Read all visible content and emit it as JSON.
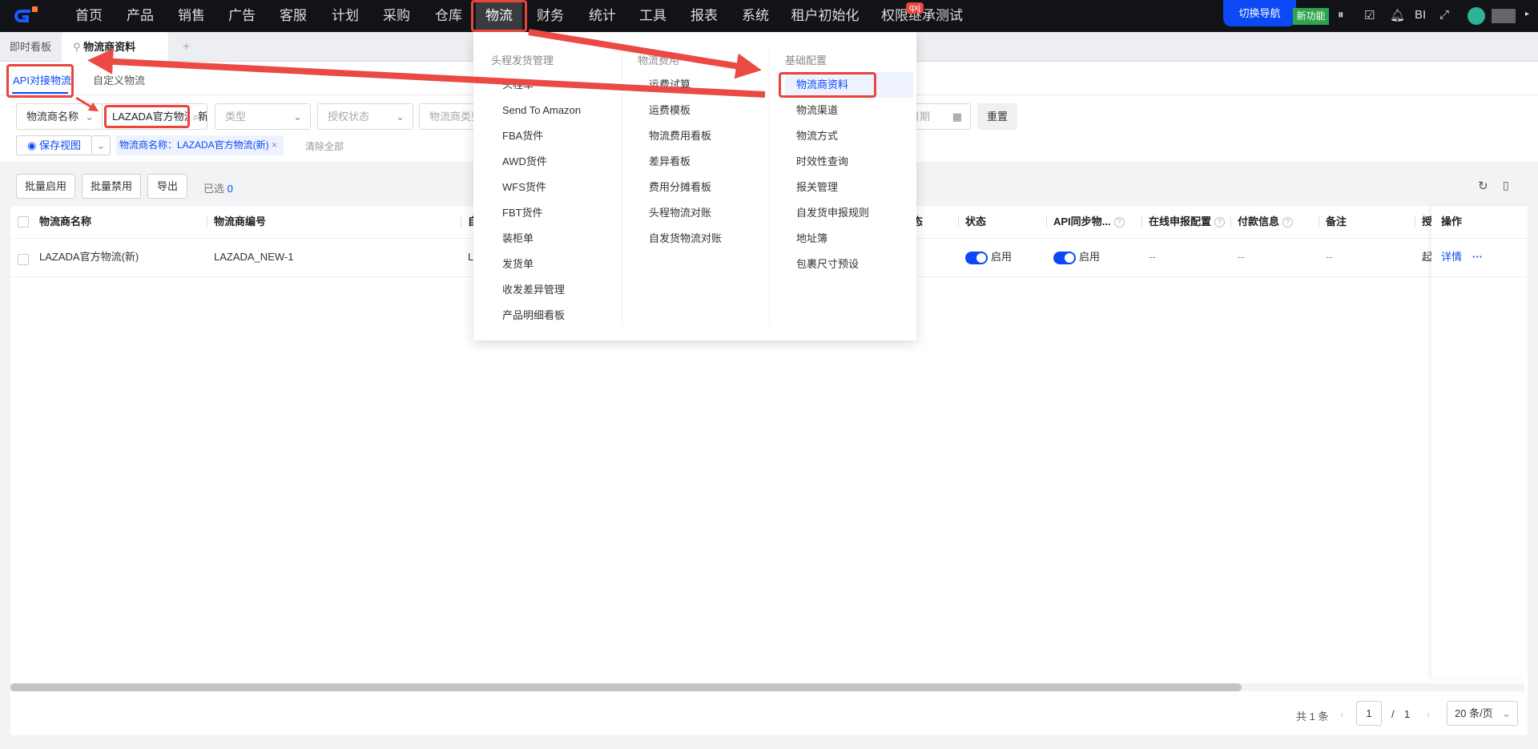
{
  "topnav": {
    "items": [
      "首页",
      "产品",
      "销售",
      "广告",
      "客服",
      "计划",
      "采购",
      "仓库",
      "物流",
      "财务",
      "统计",
      "工具",
      "报表",
      "系统",
      "租户初始化",
      "权限继承测试"
    ],
    "active": "物流",
    "badge": "qxj",
    "switch_nav": "切换导航",
    "new_feature": "新功能",
    "bi": "BI",
    "accent": "#0a49f5"
  },
  "tabs": {
    "dashboard": "即时看板",
    "current": "物流商资料",
    "add": "+"
  },
  "subtabs": [
    "API对接物流",
    "自定义物流"
  ],
  "filters": {
    "field_select": "物流商名称",
    "search_value": "LAZADA官方物流(新)",
    "type_placeholder": "类型",
    "auth_placeholder": "授权状态",
    "vendor_type_placeholder": "物流商类型",
    "date_placeholder": "日期",
    "reset": "重置",
    "save_view": "保存视图",
    "chip": "物流商名称：LAZADA官方物流(新)",
    "clear_all": "清除全部"
  },
  "toolbar": {
    "batch_enable": "批量启用",
    "batch_disable": "批量禁用",
    "export": "导出",
    "selected_label": "已选",
    "selected_count": "0"
  },
  "table": {
    "headers": [
      "物流商名称",
      "物流商编号",
      "自",
      "态",
      "状态",
      "API同步物...",
      "在线申报配置",
      "付款信息",
      "备注",
      "授",
      "操作"
    ],
    "rows": [
      {
        "name": "LAZADA官方物流(新)",
        "code": "LAZADA_NEW-1",
        "col3": "LA",
        "status": "启用",
        "api_sync": "启用",
        "online_decl": "--",
        "payment": "--",
        "remark": "--",
        "auth": "起",
        "detail": "详情",
        "more": "···"
      }
    ]
  },
  "pagination": {
    "total": "共 1 条",
    "page": "1",
    "sep": "/",
    "pages": "1",
    "page_size": "20 条/页"
  },
  "menu": {
    "columns": [
      {
        "title": "头程发货管理",
        "items": [
          "头程单",
          "Send To Amazon",
          "FBA货件",
          "AWD货件",
          "WFS货件",
          "FBT货件",
          "装柜单",
          "发货单",
          "收发差异管理",
          "产品明细看板"
        ]
      },
      {
        "title": "物流费用",
        "items": [
          "运费试算",
          "运费模板",
          "物流费用看板",
          "差异看板",
          "费用分摊看板",
          "头程物流对账",
          "自发货物流对账"
        ]
      },
      {
        "title": "基础配置",
        "items": [
          "物流商资料",
          "物流渠道",
          "物流方式",
          "时效性查询",
          "报关管理",
          "自发货申报规则",
          "地址簿",
          "包裹尺寸预设"
        ]
      }
    ],
    "highlight": "物流商资料"
  }
}
